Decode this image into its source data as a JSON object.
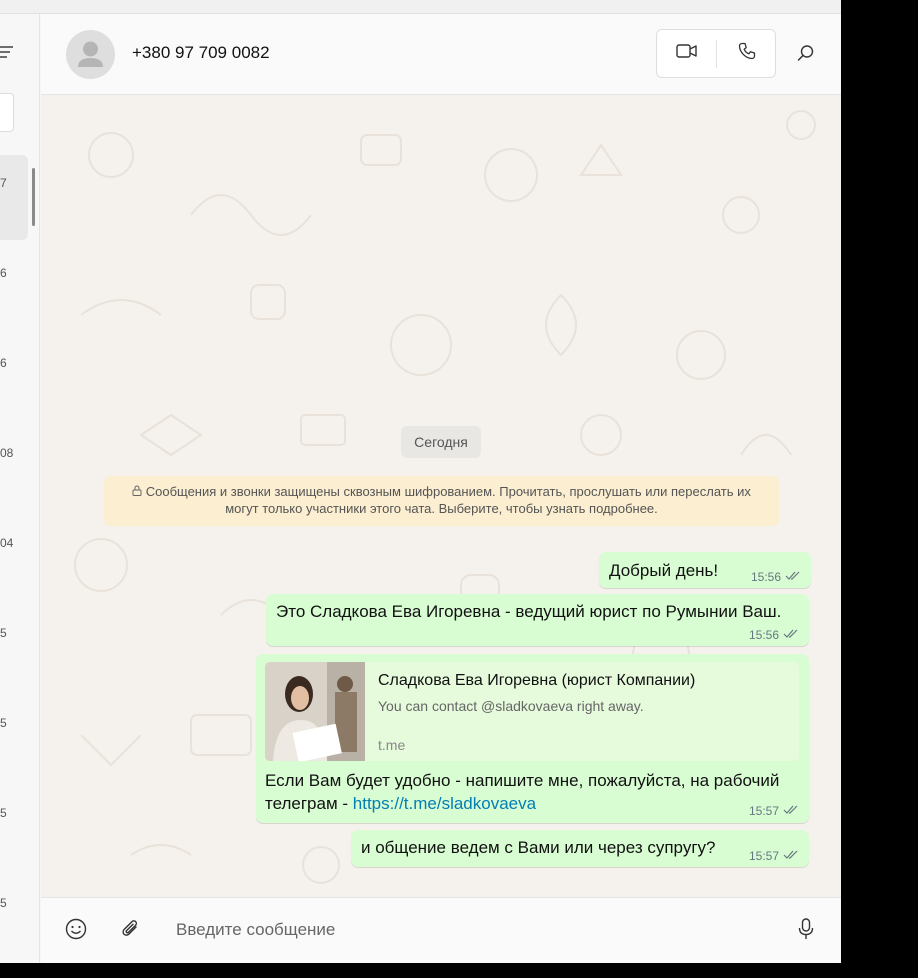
{
  "sidebar_times": [
    "7",
    "6",
    "6",
    "08",
    "04",
    "5",
    "5",
    "5",
    "5"
  ],
  "header": {
    "contact_name": "+380 97 709 0082",
    "icons": [
      "video-call-icon",
      "voice-call-icon",
      "search-icon"
    ]
  },
  "conversation": {
    "date_label": "Сегодня",
    "encryption_notice": "Сообщения и звонки защищены сквозным шифрованием. Прочитать, прослушать или переслать их могут только участники этого чата. Выберите, чтобы узнать подробнее.",
    "messages": [
      {
        "text": "Добрый день!",
        "time": "15:56"
      },
      {
        "text": "Это Сладкова Ева Игоревна - ведущий юрист по Румынии Ваш.",
        "time": "15:56"
      },
      {
        "preview": {
          "title": "Сладкова Ева Игоревна (юрист Компании)",
          "description": "You can contact @sladkovaeva right away.",
          "domain": "t.me"
        },
        "text_line1": "Если Вам будет удобно - напишите мне, пожалуйста, на рабочий",
        "text_line2_prefix": "телеграм - ",
        "link": "https://t.me/sladkovaeva",
        "time": "15:57"
      },
      {
        "text": "и общение ведем с Вами или через супругу?",
        "time": "15:57"
      }
    ]
  },
  "composer": {
    "placeholder": "Введите сообщение",
    "icons": [
      "emoji-icon",
      "attach-icon",
      "microphone-icon"
    ]
  },
  "colors": {
    "outgoing_bubble": "#d9fdd3",
    "chat_background": "#f5f1ec",
    "encryption_note": "#fbeed1",
    "link": "#027eb5",
    "read_ticks": "#667781"
  }
}
